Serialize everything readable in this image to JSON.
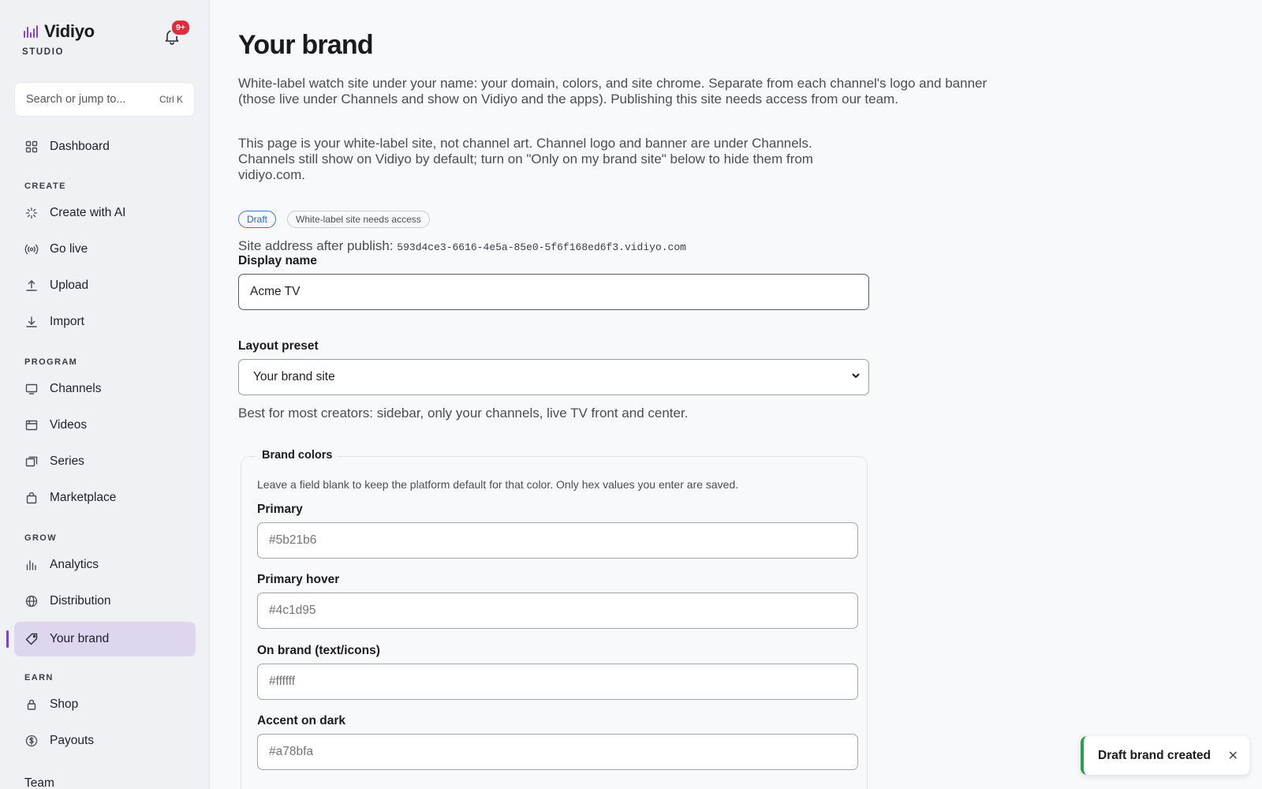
{
  "app": {
    "name": "Vidiyo",
    "subtitle": "STUDIO",
    "notification_count": "9+"
  },
  "search": {
    "placeholder": "Search or jump to...",
    "shortcut": "Ctrl K"
  },
  "nav": {
    "dashboard": "Dashboard",
    "sections": {
      "create": "CREATE",
      "program": "PROGRAM",
      "grow": "GROW",
      "earn": "EARN"
    },
    "create_with_ai": "Create with AI",
    "go_live": "Go live",
    "upload": "Upload",
    "import": "Import",
    "channels": "Channels",
    "videos": "Videos",
    "series": "Series",
    "marketplace": "Marketplace",
    "analytics": "Analytics",
    "distribution": "Distribution",
    "your_brand": "Your brand",
    "shop": "Shop",
    "payouts": "Payouts",
    "team": "Team"
  },
  "page": {
    "title": "Your brand",
    "lead": "White-label watch site under your name: your domain, colors, and site chrome. Separate from each channel's logo and banner (those live under Channels and show on Vidiyo and the apps). Publishing this site needs access from our team.",
    "note": "This page is your white-label site, not channel art. Channel logo and banner are under Channels. Channels still show on Vidiyo by default; turn on \"Only on my brand site\" below to hide them from vidiyo.com.",
    "badge_draft": "Draft",
    "badge_access": "White-label site needs access",
    "site_address_label": "Site address after publish:",
    "site_address": "593d4ce3-6616-4e5a-85e0-5f6f168ed6f3.vidiyo.com",
    "display_name_label": "Display name",
    "display_name_value": "Acme TV",
    "layout_preset_label": "Layout preset",
    "layout_preset_value": "Your brand site",
    "layout_hint": "Best for most creators: sidebar, only your channels, live TV front and center."
  },
  "brand_colors": {
    "legend": "Brand colors",
    "description": "Leave a field blank to keep the platform default for that color. Only hex values you enter are saved.",
    "primary_label": "Primary",
    "primary_placeholder": "#5b21b6",
    "primary_hover_label": "Primary hover",
    "primary_hover_placeholder": "#4c1d95",
    "on_brand_label": "On brand (text/icons)",
    "on_brand_placeholder": "#ffffff",
    "accent_on_dark_label": "Accent on dark",
    "accent_on_dark_placeholder": "#a78bfa"
  },
  "toast": {
    "message": "Draft brand created"
  },
  "colors": {
    "accent": "#7a3fd0",
    "active_nav_bg": "#ddd6ee",
    "toast_success": "#22a447",
    "badge_red": "#e02b3a",
    "draft_blue": "#3b74d8"
  }
}
